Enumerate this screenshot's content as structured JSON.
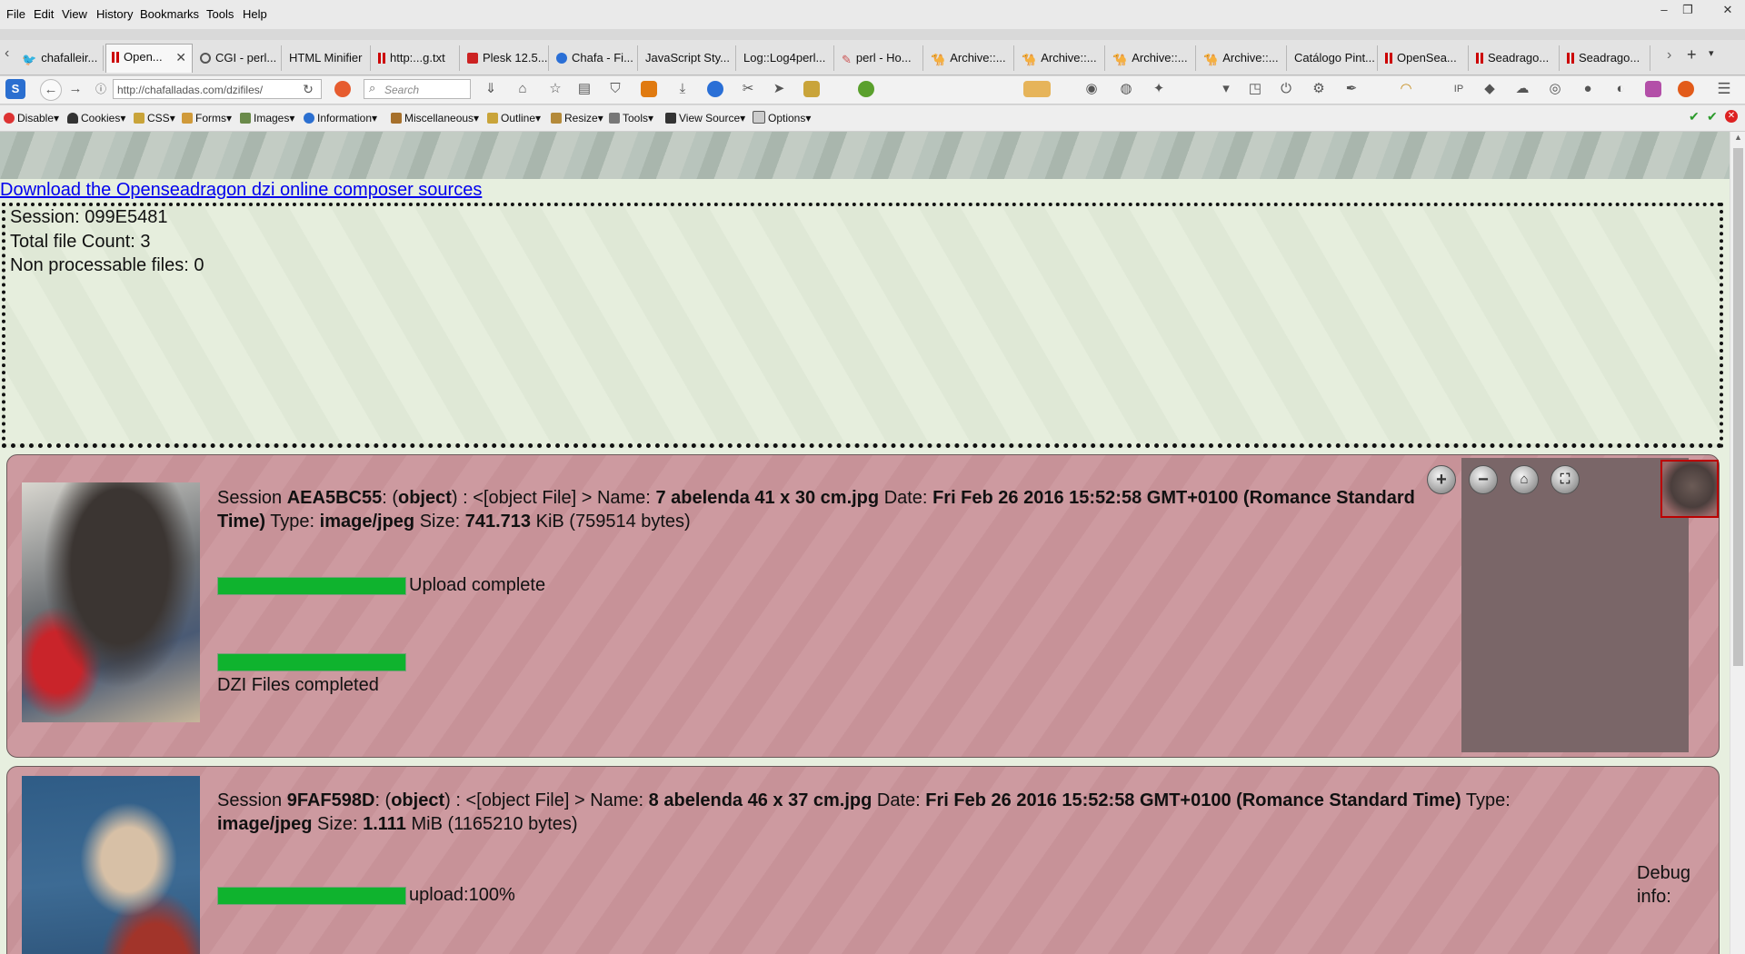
{
  "menubar": {
    "items": [
      "File",
      "Edit",
      "View",
      "History",
      "Bookmarks",
      "Tools",
      "Help"
    ],
    "window_controls": [
      "–",
      "❐",
      "✕"
    ]
  },
  "tabs": [
    {
      "label": "chafalleir...",
      "icon": "twitter-icon"
    },
    {
      "label": "Open...",
      "icon": "openseadragon-icon",
      "active": true
    },
    {
      "label": "CGI - perl...",
      "icon": "globe-icon"
    },
    {
      "label": "HTML Minifier",
      "icon": ""
    },
    {
      "label": "http:...g.txt",
      "icon": "openseadragon-icon"
    },
    {
      "label": "Plesk 12.5...",
      "icon": "plesk-icon"
    },
    {
      "label": "Chafa - Fi...",
      "icon": "firefox-icon"
    },
    {
      "label": "JavaScript Sty...",
      "icon": ""
    },
    {
      "label": "Log::Log4perl...",
      "icon": ""
    },
    {
      "label": "perl - Ho...",
      "icon": "stack-icon"
    },
    {
      "label": "Archive::...",
      "icon": "camel-icon"
    },
    {
      "label": "Archive::...",
      "icon": "camel-icon"
    },
    {
      "label": "Archive::...",
      "icon": "camel-icon"
    },
    {
      "label": "Archive::...",
      "icon": "camel-icon"
    },
    {
      "label": "Catálogo Pint...",
      "icon": ""
    },
    {
      "label": "OpenSea...",
      "icon": "openseadragon-icon"
    },
    {
      "label": "Seadrago...",
      "icon": "openseadragon-icon"
    },
    {
      "label": "Seadrago...",
      "icon": "openseadragon-icon"
    }
  ],
  "navbar": {
    "url": "http://chafalladas.com/dzifiles/",
    "search_placeholder": "Search"
  },
  "devbar": {
    "items": [
      "Disable",
      "Cookies",
      "CSS",
      "Forms",
      "Images",
      "Information",
      "Miscellaneous",
      "Outline",
      "Resize",
      "Tools",
      "View Source",
      "Options"
    ]
  },
  "page": {
    "download_link": "Download the Openseadragon dzi online composer sources",
    "session_line": "Session: 099E5481",
    "total_count_line": "Total file Count: 3",
    "non_processable_line": "Non processable files: 0"
  },
  "files": [
    {
      "session_label": "Session",
      "session_id": "AEA5BC55",
      "object_label": "object",
      "object_file": ") : <[object File] > Name:",
      "name": "7 abelenda 41 x 30 cm.jpg",
      "date_label": "Date:",
      "date": "Fri Feb 26 2016 15:52:58 GMT+0100 (Romance Standard Time)",
      "type_label": "Type:",
      "type": "image/jpeg",
      "size_label": "Size:",
      "size_value": "741.713",
      "size_unit": "KiB (759514 bytes)",
      "upload_status": "Upload complete",
      "upload_progress": 1.0,
      "dzi_status": "DZI Files completed",
      "dzi_progress": 1.0
    },
    {
      "session_label": "Session",
      "session_id": "9FAF598D",
      "object_label": "object",
      "object_file": ") : <[object File] > Name:",
      "name": "8 abelenda 46 x 37 cm.jpg",
      "date_label": "Date:",
      "date": "Fri Feb 26 2016 15:52:58 GMT+0100 (Romance Standard Time)",
      "type_label": "Type:",
      "type": "image/jpeg",
      "size_label": "Size:",
      "size_value": "1.111",
      "size_unit": "MiB (1165210 bytes)",
      "upload_status": "upload:100%",
      "upload_progress": 1.0
    }
  ],
  "viewer": {
    "buttons": [
      "zoom-in",
      "zoom-out",
      "home",
      "fullscreen"
    ]
  },
  "debug": {
    "label": "Debug info:"
  },
  "colors": {
    "progress": "#0fb32e",
    "card_bg": "#cd9aa0",
    "link": "#0000ee",
    "dropzone_bg": "#e7efdf"
  }
}
